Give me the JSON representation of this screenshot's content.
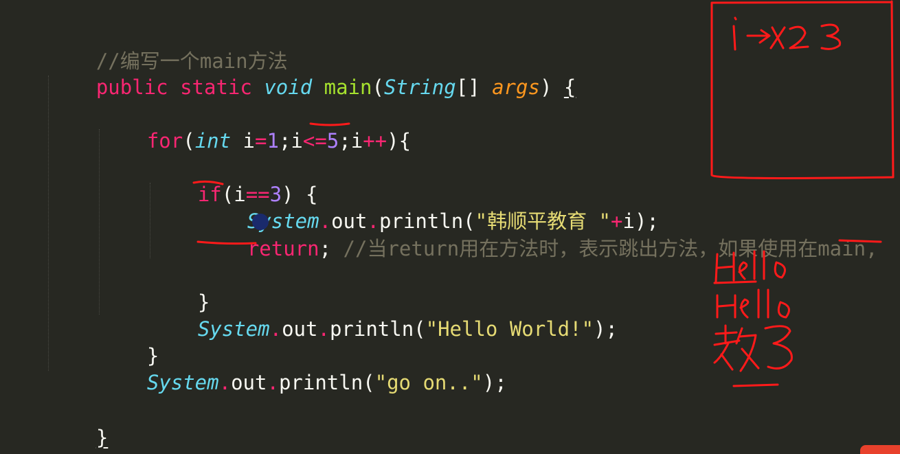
{
  "editor": {
    "theme_colors": {
      "background": "#272822",
      "keyword": "#F92672",
      "type": "#66D9EF",
      "function": "#A6E22E",
      "argument": "#FD971F",
      "number": "#AE81FF",
      "string": "#E6DB74",
      "comment": "#75715E",
      "plain": "#F8F8F2"
    },
    "lines": {
      "comment_main": "//编写一个main方法",
      "sig_public": "public",
      "sig_static": "static",
      "sig_void": "void",
      "sig_main": "main",
      "sig_open": "(",
      "sig_string": "String",
      "sig_brackets": "[] ",
      "sig_args": "args",
      "sig_close": ") ",
      "sig_brace": "{",
      "for_kw": "for",
      "for_open": "(",
      "for_int": "int",
      "for_i": " i",
      "for_eq": "=",
      "for_1": "1",
      "for_semi1": ";i",
      "for_le": "<=",
      "for_5": "5",
      "for_semi2": ";",
      "for_i2": "i",
      "for_pp": "++",
      "for_close": "){",
      "if_kw": "if",
      "if_open": "(i",
      "if_eq": "==",
      "if_3": "3",
      "if_close": ") {",
      "p1_system": "System",
      "p1_dot1": ".",
      "p1_out": "out",
      "p1_dot2": ".",
      "p1_println": "println(",
      "p1_str": "\"韩顺平教育 \"",
      "p1_plus": "+",
      "p1_end": "i);",
      "ret_kw": "return",
      "ret_semi": "; ",
      "ret_comment": "//当return用在方法时，表示跳出方法，如果使用在main,",
      "if_end": "}",
      "p2_system": "System",
      "p2_dot1": ".",
      "p2_out": "out",
      "p2_dot2": ".",
      "p2_println": "println(",
      "p2_str": "\"Hello World!\"",
      "p2_end": ");",
      "for_end": "}",
      "p3_system": "System",
      "p3_dot1": ".",
      "p3_out": "out",
      "p3_dot2": ".",
      "p3_println": "println(",
      "p3_str": "\"go on..\"",
      "p3_end": ");",
      "main_end": "}",
      "class_end": "}"
    }
  },
  "annotations": {
    "ink_color": "#ff1a1a",
    "box_note": "i →x 2 3",
    "output_notes": [
      "Hello",
      "Hello",
      "教 3"
    ]
  }
}
